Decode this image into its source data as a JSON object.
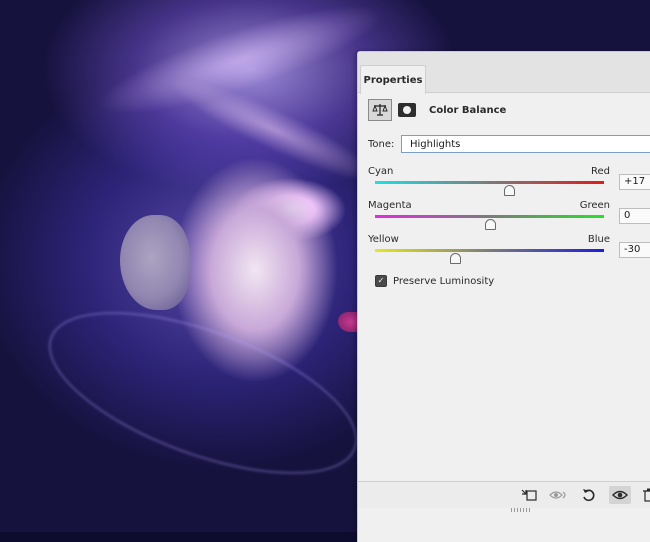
{
  "panel": {
    "tab_label": "Properties",
    "adjustment_title": "Color Balance",
    "tone_label": "Tone:",
    "tone_value": "Highlights",
    "sliders": [
      {
        "left_label": "Cyan",
        "right_label": "Red",
        "value": "+17",
        "min": -100,
        "max": 100,
        "numeric": 17,
        "track_colors": [
          "#19e2e8",
          "#e21b1b"
        ]
      },
      {
        "left_label": "Magenta",
        "right_label": "Green",
        "value": "0",
        "min": -100,
        "max": 100,
        "numeric": 0,
        "track_colors": [
          "#e22ae2",
          "#27e227"
        ]
      },
      {
        "left_label": "Yellow",
        "right_label": "Blue",
        "value": "-30",
        "min": -100,
        "max": 100,
        "numeric": -30,
        "track_colors": [
          "#e8e81a",
          "#1c1ce2"
        ]
      }
    ],
    "preserve_luminosity": {
      "label": "Preserve Luminosity",
      "checked": true
    },
    "bottom_icons": [
      "clip-to-layer-icon",
      "view-previous-state-icon",
      "reset-icon",
      "visibility-eye-icon",
      "trash-icon"
    ]
  }
}
